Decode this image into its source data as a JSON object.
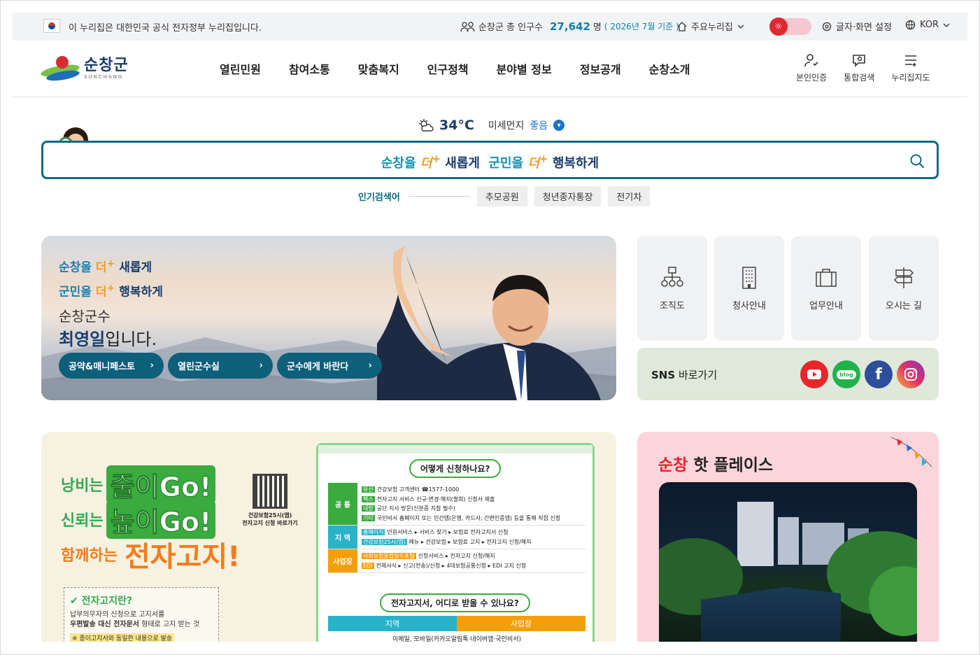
{
  "topbar": {
    "gov_notice": "이 누리집은 대한민국 공식 전자정부 누리집입니다.",
    "population_label": "순창군 총 인구수",
    "population_value": "27,642",
    "population_unit": "명",
    "population_note": "( 2026년 7월 기준 )",
    "portal_label": "주요누리집",
    "text_setting_label": "글자·화면 설정",
    "lang_label": "KOR"
  },
  "header": {
    "logo_kr": "순창군",
    "logo_en": "SUNCHANG",
    "nav": [
      "열린민원",
      "참여소통",
      "맞춤복지",
      "인구정책",
      "분야별 정보",
      "정보공개",
      "순창소개"
    ],
    "quick": [
      "본인인증",
      "통합검색",
      "누리집지도"
    ]
  },
  "weather": {
    "temp": "34°C",
    "dust_label": "미세먼지",
    "dust_value": "좋음"
  },
  "search": {
    "slogan_a": "순창을",
    "slogan_plus": "더",
    "slogan_b": "새롭게",
    "slogan_c": "군민을",
    "slogan_d": "행복하게"
  },
  "popular": {
    "label": "인기검색어",
    "tags": [
      "추모공원",
      "청년종자통장",
      "전기차"
    ]
  },
  "hero": {
    "line1_a": "순창을",
    "line1_plus": "더",
    "line1_b": "새롭게",
    "line2_a": "군민을",
    "line2_b": "행복하게",
    "role": "순창군수",
    "name": "최영일",
    "name_suffix": "입니다.",
    "buttons": [
      "공약&매니페스토",
      "열린군수실",
      "군수에게 바란다"
    ]
  },
  "tiles": [
    "조직도",
    "청사안내",
    "업무안내",
    "오시는 길"
  ],
  "sns": {
    "title_bold": "SNS",
    "title_rest": "바로가기",
    "blog_label": "blog",
    "facebook_label": "f"
  },
  "promo": {
    "l1_small": "낭비는",
    "l1_big": "줄이Go!",
    "l2_small": "신뢰는",
    "l2_big": "높이Go!",
    "l3_small": "함께하는",
    "l3_big": "전자고지!",
    "qr_caption_a": "건강보험25시(앱)",
    "qr_caption_b": "전자고지 신청 바로가기",
    "what_title": "전자고지란?",
    "what_line1": "납부의무자의 신청으로 고지서를",
    "what_line2_bold": "우편발송 대신 전자문서",
    "what_line2_rest": " 형태로 고지 받는 것",
    "what_note": "※ 종이고지서와 동일한 내용으로 발송",
    "q1": "어떻게 신청하나요?",
    "rows": [
      {
        "cat": "공 통",
        "lines": [
          {
            "k": "유선",
            "t": "건강보험 고객센터 ☎1577-1000"
          },
          {
            "k": "팩스",
            "t": "전자고지 서비스 신규·변경·해지(철회) 신청서 제출"
          },
          {
            "k": "내방",
            "t": "공단 지사 방문(신분증 지참 필수)"
          },
          {
            "k": "기타",
            "t": "국민비서 홈페이지 또는 민간앱(은행, 카드사, 간편인증앱) 등을 통해 직접 신청"
          }
        ]
      },
      {
        "cat": "지 역",
        "lines": [
          {
            "k": "홈페이지",
            "t": "민원서비스 ▸ 서비스 찾기 ▸ 보험료 전자고지서 신청"
          },
          {
            "k": "건강보험25시(앱)",
            "t": "메뉴 ▸ 건강보험 ▸ 보험료 고지 ▸ 전자고지 신청/해지"
          }
        ]
      },
      {
        "cat": "사업장",
        "lines": [
          {
            "k": "사회보험통합징수포털",
            "t": "신청서비스 ▸ 전자고지 신청/해지"
          },
          {
            "k": "EDI",
            "t": "전체서식 ▸ 신고(전송)/신청 ▸ 4대보험공통신청 ▸ EDI 고지 신청"
          }
        ]
      }
    ],
    "q2": "전자고지서, 어디로 받을 수 있나요?",
    "tab_left": "지역",
    "tab_right": "사업장",
    "tab_caption": "이메일, 모바일(카카오알림톡·네이버앱·국민비서)"
  },
  "hot": {
    "title_red": "순창",
    "title_rest": " 핫 플레이스"
  },
  "colors": {
    "accent_teal": "#0e6c82",
    "brand_navy": "#1a3d6d",
    "accent_orange": "#f29a1f",
    "alert_red": "#e0262e"
  }
}
